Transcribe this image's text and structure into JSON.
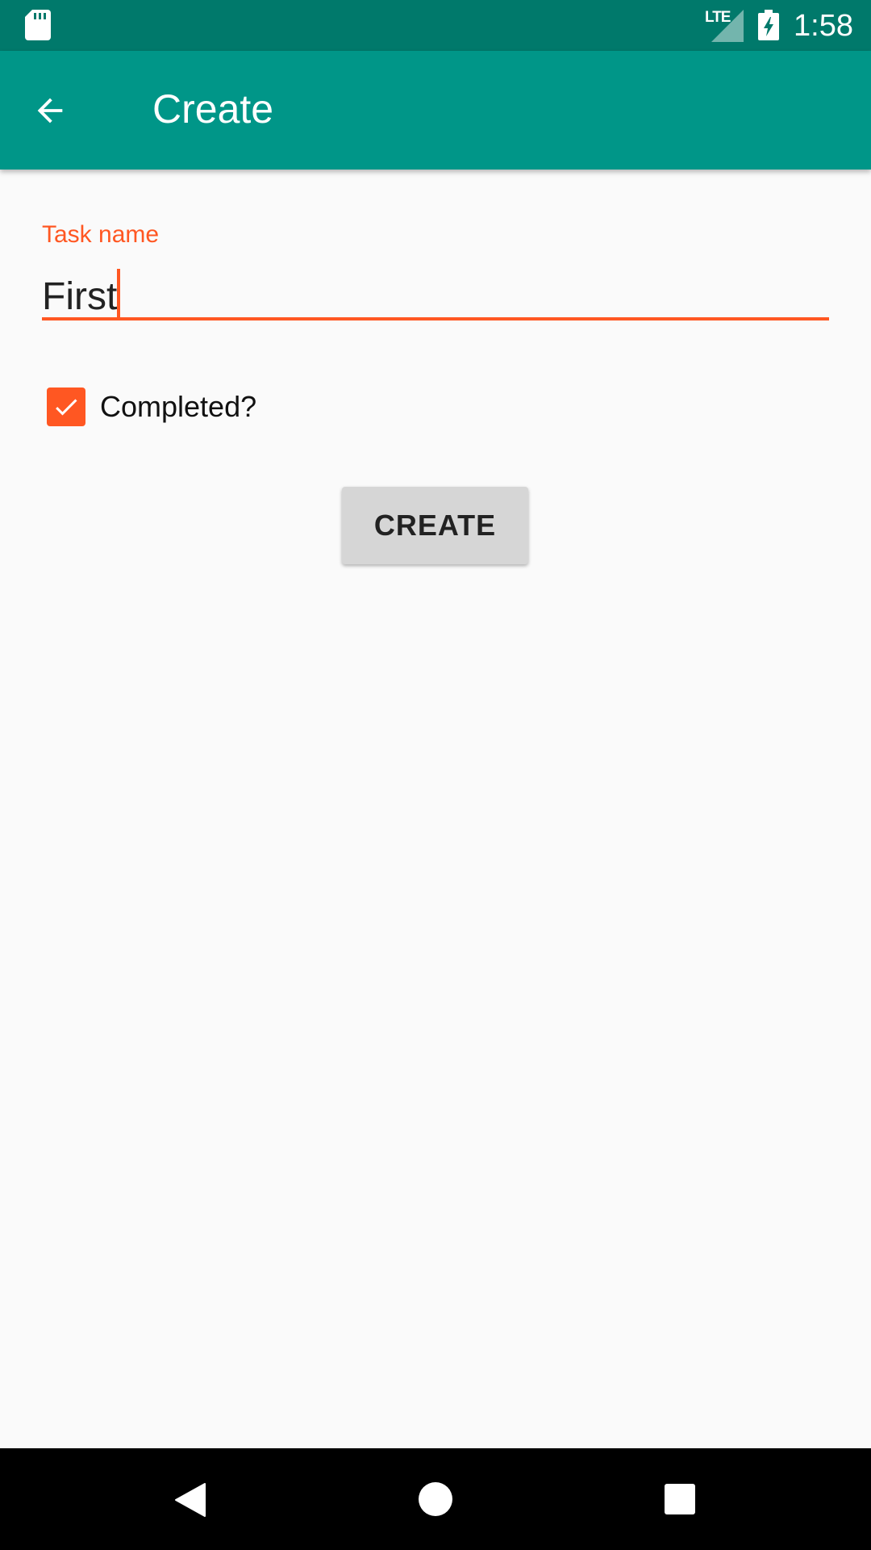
{
  "status_bar": {
    "network": "LTE",
    "time": "1:58",
    "icons": [
      "sd-card-icon",
      "signal-icon",
      "battery-charging-icon"
    ]
  },
  "app_bar": {
    "title": "Create",
    "back_icon": "arrow-back-icon",
    "color": "#009688"
  },
  "form": {
    "task_name": {
      "label": "Task name",
      "value": "First"
    },
    "completed": {
      "label": "Completed?",
      "checked": true
    },
    "create_button": "CREATE"
  },
  "nav_bar": {
    "icons": [
      "nav-back-icon",
      "nav-home-icon",
      "nav-recents-icon"
    ]
  },
  "colors": {
    "status_bar": "#00796b",
    "app_bar": "#009688",
    "accent": "#ff5722",
    "background": "#fafafa"
  }
}
